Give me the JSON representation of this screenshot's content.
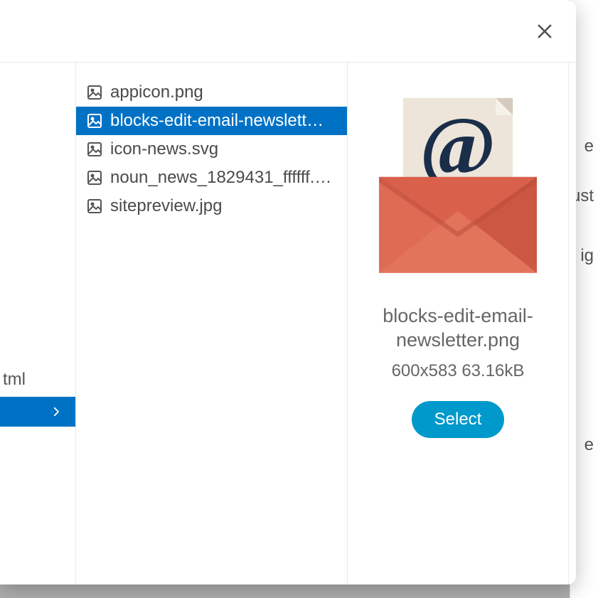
{
  "background": {
    "leftPartial": "tml",
    "rightFragments": [
      "e",
      "ust",
      "ig",
      "e"
    ]
  },
  "files": [
    {
      "name": "appicon.png",
      "selected": false
    },
    {
      "name": "blocks-edit-email-newslett…",
      "selected": true
    },
    {
      "name": "icon-news.svg",
      "selected": false
    },
    {
      "name": "noun_news_1829431_ffffff.…",
      "selected": false
    },
    {
      "name": "sitepreview.jpg",
      "selected": false
    }
  ],
  "preview": {
    "filename": "blocks-edit-email-newsletter.png",
    "meta": "600x583 63.16kB",
    "selectLabel": "Select"
  }
}
